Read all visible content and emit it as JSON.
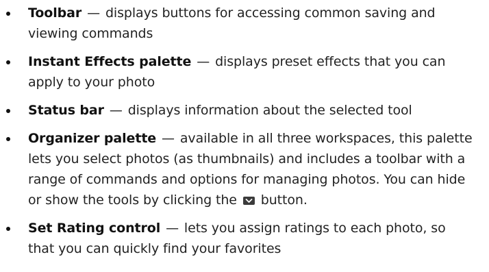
{
  "items": [
    {
      "term": "Toolbar",
      "dash": "—",
      "text": " displays buttons for accessing common saving and viewing commands"
    },
    {
      "term": "Instant Effects palette",
      "dash": "—",
      "text": " displays preset effects that you can apply to your photo"
    },
    {
      "term": "Status bar",
      "dash": "—",
      "text": " displays information about the selected tool"
    },
    {
      "term": "Organizer palette",
      "dash": "—",
      "text": " available in all three workspaces, this palette lets you select photos (as thumbnails) and includes a toolbar with a range of commands and options for managing photos. You can hide or show the tools by clicking the",
      "icon": "chevron-down-icon",
      "text_after": " button."
    },
    {
      "term": "Set Rating control",
      "dash": "—",
      "text": " lets you assign ratings to each photo, so that you can quickly find your favorites"
    }
  ]
}
